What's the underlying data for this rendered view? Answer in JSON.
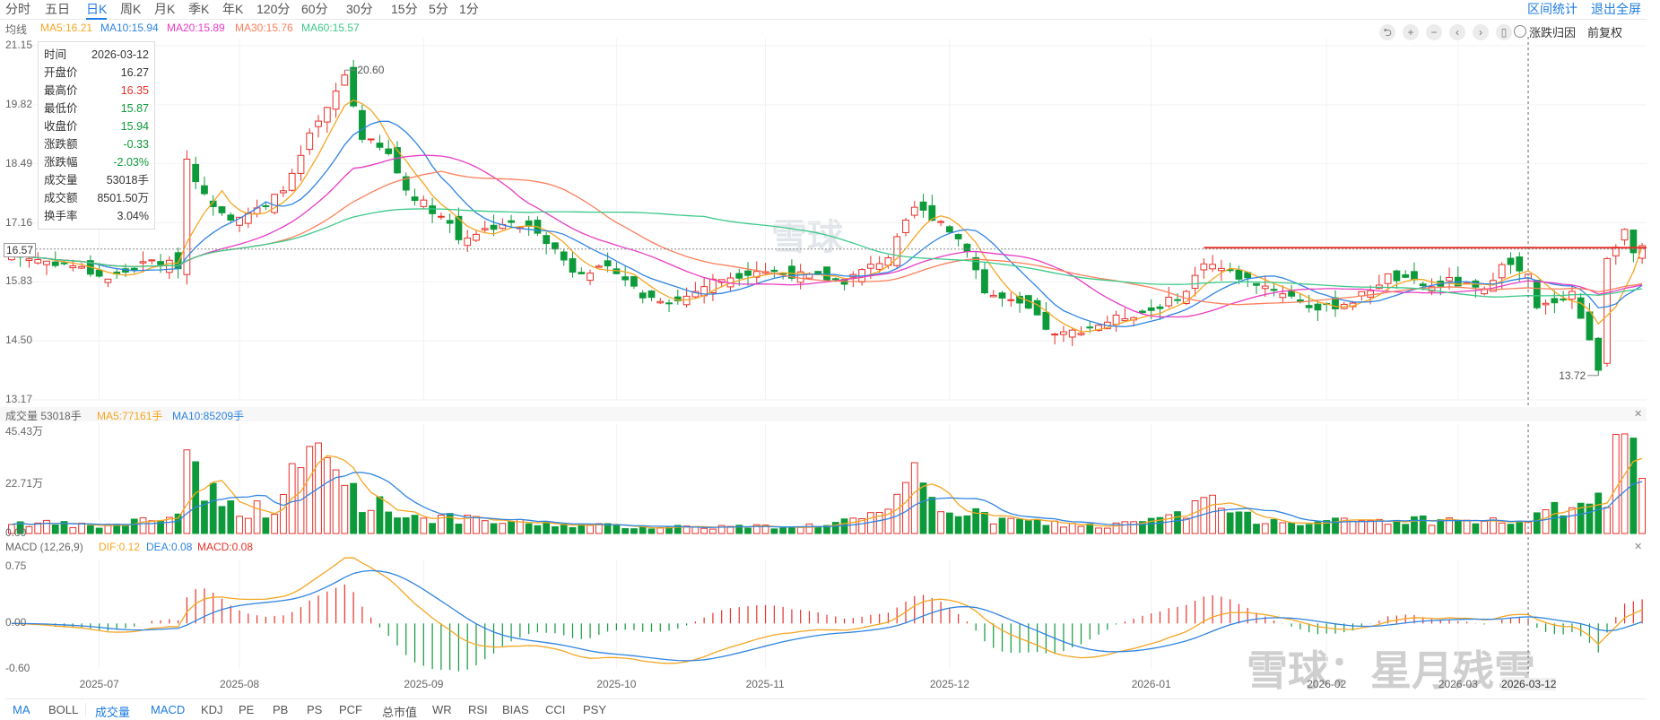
{
  "tabs": [
    "分时",
    "五日",
    "日K",
    "周K",
    "月K",
    "季K",
    "年K",
    "120分",
    "60分",
    "30分",
    "15分",
    "5分",
    "1分"
  ],
  "active_tab": "日K",
  "top_links": {
    "interval_stats": "区间统计",
    "exit_fullscreen": "退出全屏"
  },
  "ma_legend": {
    "label": "均线",
    "ma5": "MA5:16.21",
    "ma10": "MA10:15.94",
    "ma20": "MA20:15.89",
    "ma30": "MA30:15.76",
    "ma60": "MA60:15.57"
  },
  "controls": {
    "attribution": "涨跌归因",
    "adjust": "前复权"
  },
  "tooltip": [
    {
      "k": "时间",
      "v": "2026-03-12",
      "c": "#333"
    },
    {
      "k": "开盘价",
      "v": "16.27",
      "c": "#333"
    },
    {
      "k": "最高价",
      "v": "16.35",
      "c": "#e8312a"
    },
    {
      "k": "最低价",
      "v": "15.87",
      "c": "#0d9a3a"
    },
    {
      "k": "收盘价",
      "v": "15.94",
      "c": "#0d9a3a"
    },
    {
      "k": "涨跌额",
      "v": "-0.33",
      "c": "#0d9a3a"
    },
    {
      "k": "涨跌幅",
      "v": "-2.03%",
      "c": "#0d9a3a"
    },
    {
      "k": "成交量",
      "v": "53018手",
      "c": "#333"
    },
    {
      "k": "成交额",
      "v": "8501.50万",
      "c": "#333"
    },
    {
      "k": "换手率",
      "v": "3.04%",
      "c": "#333"
    }
  ],
  "crosshair": {
    "price_label": "16.57",
    "date_label": "2026-03-12"
  },
  "volume_legend": {
    "label": "成交量 53018手",
    "ma5": "MA5:77161手",
    "ma10": "MA10:85209手"
  },
  "macd_legend": {
    "label": "MACD (12,26,9)",
    "dif": "DIF:0.12",
    "dea": "DEA:0.08",
    "macd": "MACD:0.08"
  },
  "bottom_tabs": [
    "MA",
    "BOLL",
    "成交量",
    "MACD",
    "KDJ",
    "PE",
    "PB",
    "PS",
    "PCF",
    "总市值",
    "WR",
    "RSI",
    "BIAS",
    "CCI",
    "PSY"
  ],
  "watermark": {
    "center": "雪球",
    "corner": "雪球：星月残雪"
  },
  "colors": {
    "up": "#e8312a",
    "down": "#0d9a3a",
    "ma5": "#f5a623",
    "ma10": "#2f84e0",
    "ma20": "#e93cc3",
    "ma30": "#fb7f5b",
    "ma60": "#3cc98a",
    "accent": "#1f7ce0"
  },
  "chart_data": {
    "type": "candlestick",
    "candle_count": 187,
    "price_axis": {
      "ticks": [
        "21.15",
        "19.82",
        "18.49",
        "17.16",
        "15.83",
        "14.50",
        "13.17"
      ],
      "range": [
        13.17,
        21.15
      ]
    },
    "volume_axis": {
      "ticks": [
        "45.43万",
        "22.71万",
        "0.00"
      ],
      "range": [
        0,
        45.43
      ],
      "unit": "万手"
    },
    "macd_axis": {
      "ticks": [
        "0.75",
        "0.00",
        "-0.60"
      ],
      "range": [
        -0.6,
        0.75
      ]
    },
    "date_ticks": [
      {
        "label": "2025-07",
        "index": 10
      },
      {
        "label": "2025-08",
        "index": 26
      },
      {
        "label": "2025-09",
        "index": 47
      },
      {
        "label": "2025-10",
        "index": 69
      },
      {
        "label": "2025-11",
        "index": 86
      },
      {
        "label": "2025-12",
        "index": 107
      },
      {
        "label": "2026-01",
        "index": 130
      },
      {
        "label": "2026-02",
        "index": 150
      },
      {
        "label": "2026-03",
        "index": 165
      },
      {
        "label": "2026-03-12",
        "index": 173
      }
    ],
    "close_keypoints": [
      [
        0,
        16.43
      ],
      [
        7,
        16.2
      ],
      [
        11,
        15.9
      ],
      [
        16,
        16.3
      ],
      [
        19,
        16.2
      ],
      [
        20,
        18.6
      ],
      [
        22,
        17.75
      ],
      [
        25,
        17.3
      ],
      [
        29,
        17.5
      ],
      [
        32,
        18.2
      ],
      [
        34,
        19.1
      ],
      [
        36,
        19.7
      ],
      [
        38,
        20.5
      ],
      [
        40,
        19.1
      ],
      [
        43,
        18.7
      ],
      [
        45,
        17.9
      ],
      [
        50,
        17.15
      ],
      [
        51,
        16.8
      ],
      [
        56,
        17.15
      ],
      [
        60,
        17.0
      ],
      [
        64,
        16.1
      ],
      [
        69,
        16.1
      ],
      [
        72,
        15.5
      ],
      [
        76,
        15.4
      ],
      [
        80,
        15.85
      ],
      [
        85,
        16.1
      ],
      [
        89,
        16.0
      ],
      [
        95,
        15.85
      ],
      [
        100,
        16.4
      ],
      [
        103,
        17.5
      ],
      [
        106,
        17.2
      ],
      [
        109,
        16.6
      ],
      [
        111,
        15.6
      ],
      [
        116,
        15.2
      ],
      [
        119,
        14.6
      ],
      [
        121,
        14.7
      ],
      [
        126,
        15.0
      ],
      [
        130,
        15.2
      ],
      [
        134,
        15.6
      ],
      [
        136,
        16.3
      ],
      [
        140,
        15.95
      ],
      [
        145,
        15.6
      ],
      [
        149,
        15.2
      ],
      [
        153,
        15.4
      ],
      [
        157,
        15.95
      ],
      [
        162,
        15.7
      ],
      [
        164,
        15.85
      ],
      [
        168,
        15.6
      ],
      [
        170,
        16.3
      ],
      [
        173,
        15.94
      ],
      [
        174,
        15.2
      ],
      [
        178,
        15.6
      ],
      [
        181,
        13.9
      ],
      [
        182,
        16.4
      ],
      [
        184,
        17.0
      ],
      [
        185,
        16.4
      ],
      [
        186,
        16.6
      ]
    ],
    "volume_keypoints_wan": [
      [
        0,
        5
      ],
      [
        10,
        3
      ],
      [
        19,
        8
      ],
      [
        20,
        45.4
      ],
      [
        21,
        28
      ],
      [
        24,
        12
      ],
      [
        30,
        10
      ],
      [
        33,
        30
      ],
      [
        35,
        36
      ],
      [
        37,
        28
      ],
      [
        40,
        15
      ],
      [
        45,
        8
      ],
      [
        55,
        5
      ],
      [
        70,
        3
      ],
      [
        90,
        3
      ],
      [
        100,
        8
      ],
      [
        103,
        25
      ],
      [
        106,
        12
      ],
      [
        112,
        6
      ],
      [
        125,
        3
      ],
      [
        134,
        8
      ],
      [
        136,
        17
      ],
      [
        140,
        7
      ],
      [
        150,
        5
      ],
      [
        160,
        6
      ],
      [
        172,
        5
      ],
      [
        176,
        10
      ],
      [
        182,
        15
      ],
      [
        183,
        35
      ],
      [
        186,
        30
      ]
    ],
    "annotations": [
      {
        "label": "20.60",
        "index": 38,
        "value": 20.6
      },
      {
        "label": "13.72",
        "index": 181,
        "value": 13.72
      }
    ],
    "resistance_line": {
      "value": 16.6,
      "from_index": 136
    },
    "ma_periods": [
      5,
      10,
      20,
      30,
      60
    ],
    "macd_params": [
      12,
      26,
      9
    ]
  }
}
